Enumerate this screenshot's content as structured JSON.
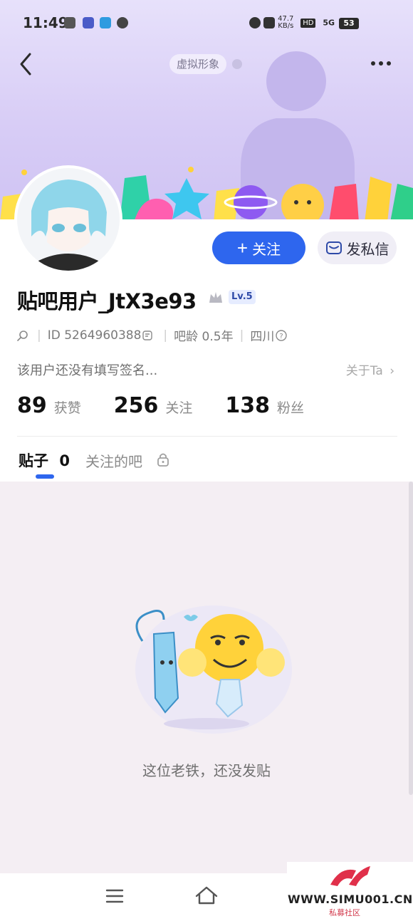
{
  "status_bar": {
    "time": "11:49",
    "net_speed_value": "47.7",
    "net_speed_unit": "KB/s",
    "hd": "HD",
    "network": "5G",
    "battery": "53"
  },
  "header": {
    "avatar_pill": "虚拟形象"
  },
  "actions": {
    "follow_label": "关注",
    "message_label": "发私信"
  },
  "profile": {
    "username": "贴吧用户_JtX3e93",
    "level": "Lv.5",
    "id": "ID 5264960388",
    "bar_age": "吧龄 0.5年",
    "location": "四川",
    "signature": "该用户还没有填写签名...",
    "about": "关于Ta"
  },
  "stats": {
    "likes_count": "89",
    "likes_label": "获赞",
    "following_count": "256",
    "following_label": "关注",
    "fans_count": "138",
    "fans_label": "粉丝"
  },
  "tabs": {
    "posts_label": "贴子",
    "posts_count": "0",
    "forums_label": "关注的吧"
  },
  "empty_state": {
    "text": "这位老铁，还没发贴"
  },
  "watermark": {
    "url": "WWW.SIMU001.CN",
    "sub": "私募社区"
  },
  "colors": {
    "accent": "#2e66ee",
    "header_bg": "#d8cdf6",
    "page_bg": "#f4eef3"
  }
}
